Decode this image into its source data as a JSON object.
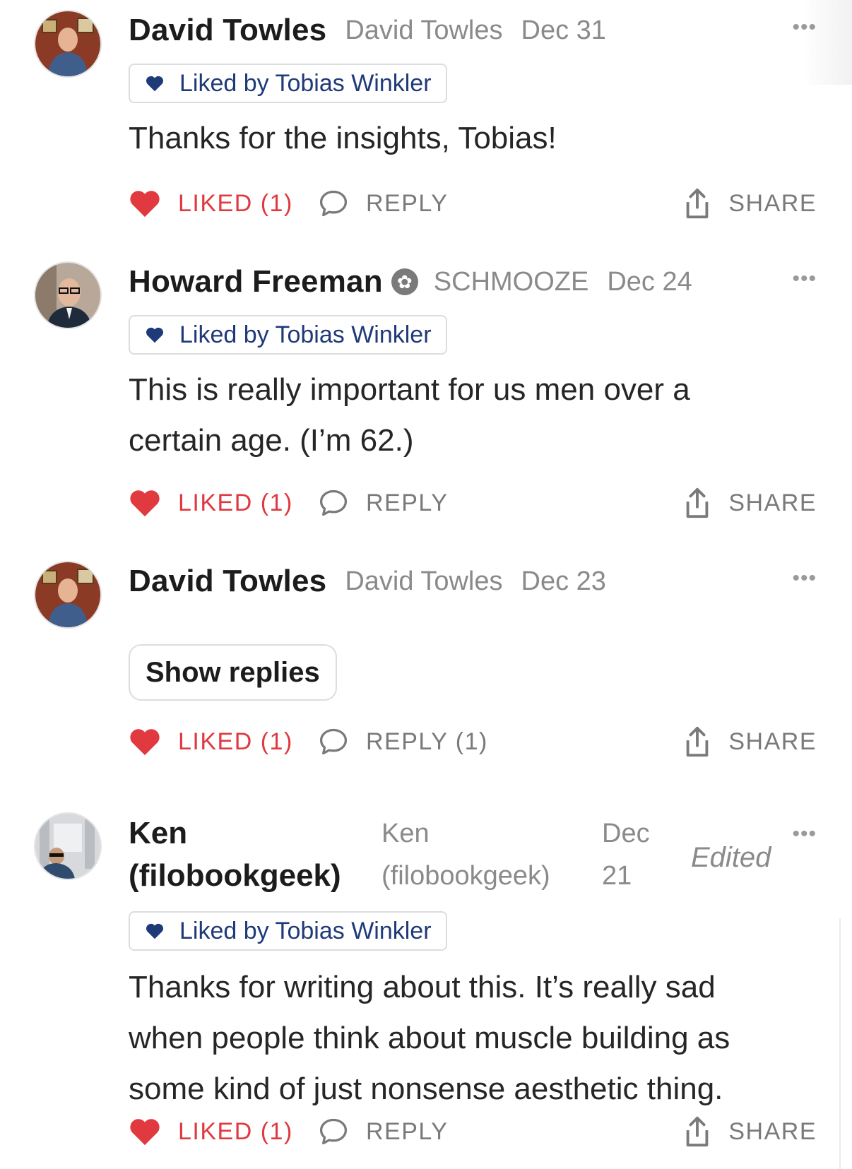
{
  "comments": [
    {
      "author": "David Towles",
      "handle": "David Towles",
      "date": "Dec 31",
      "liked_by": "Liked by Tobias Winkler",
      "text": "Thanks for the insights, Tobias!",
      "like_label": "LIKED (1)",
      "reply_label": "REPLY",
      "share_label": "SHARE",
      "more": "•••"
    },
    {
      "author": "Howard Freeman",
      "badge": "✿",
      "handle": "SCHMOOZE",
      "date": "Dec 24",
      "liked_by": "Liked by Tobias Winkler",
      "text_line1": "This is really important for us men over a",
      "text_line2": "certain age. (I’m 62.)",
      "like_label": "LIKED (1)",
      "reply_label": "REPLY",
      "share_label": "SHARE",
      "more": "•••"
    },
    {
      "author": "David Towles",
      "handle": "David Towles",
      "date": "Dec 23",
      "show_replies": "Show replies",
      "like_label": "LIKED (1)",
      "reply_label": "REPLY (1)",
      "share_label": "SHARE",
      "more": "•••"
    },
    {
      "author_line1": "Ken",
      "author_line2": "(filobookgeek)",
      "handle_line1": "Ken",
      "handle_line2": "(filobookgeek)",
      "date_line1": "Dec",
      "date_line2": "21",
      "edited": "Edited",
      "liked_by": "Liked by Tobias Winkler",
      "text_line1": "Thanks for writing about this. It’s really sad",
      "text_line2": "when people think about muscle building as",
      "text_line3": "some kind of just nonsense aesthetic thing.",
      "like_label": "LIKED (1)",
      "reply_label": "REPLY",
      "share_label": "SHARE",
      "more": "•••"
    }
  ],
  "icons": {
    "like": "heart-icon",
    "reply": "speech-bubble-icon",
    "share": "share-icon",
    "more": "ellipsis-icon"
  },
  "colors": {
    "liked_red": "#e0393f",
    "liked_by_blue": "#1f3a78",
    "muted": "#8a8a8a"
  }
}
